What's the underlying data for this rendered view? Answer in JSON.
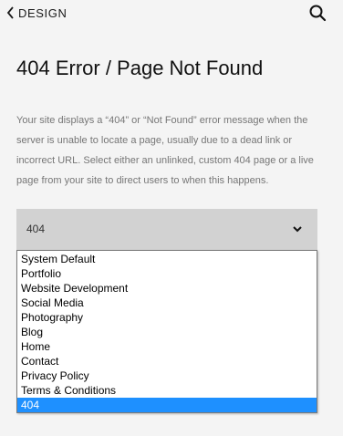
{
  "header": {
    "back_label": "DESIGN",
    "back_icon": "chevron-left-icon",
    "search_icon": "search-icon"
  },
  "page": {
    "title": "404 Error / Page Not Found",
    "description": "Your site displays a “404” or “Not Found” error message when the server is unable to locate a page, usually due to a dead link or incorrect URL. Select either an unlinked, custom 404 page or a live page from your site to direct users to when this happens."
  },
  "select": {
    "value": "404",
    "chevron_icon": "chevron-down-icon",
    "background": "#d2d2d2"
  },
  "dropdown": {
    "options": [
      "System Default",
      "Portfolio",
      "Website Development",
      "Social Media",
      "Photography",
      "Blog",
      "Home",
      "Contact",
      "Privacy Policy",
      "Terms & Conditions",
      "404"
    ],
    "selected_index": 10,
    "highlight_color": "#1e90ff"
  },
  "colors": {
    "background": "#f4f4f4",
    "description_text": "#767676"
  }
}
